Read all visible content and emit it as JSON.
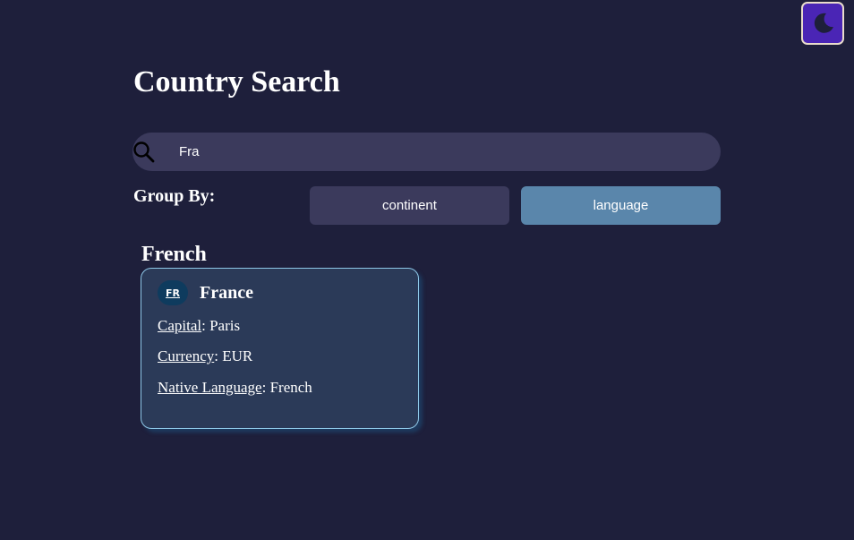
{
  "header": {
    "title": "Country Search",
    "theme_toggle_icon": "moon-icon"
  },
  "search": {
    "value": "Fra",
    "icon": "search-icon"
  },
  "group_by": {
    "label": "Group By:",
    "options": [
      {
        "label": "continent",
        "selected": false
      },
      {
        "label": "language",
        "selected": true
      }
    ]
  },
  "results": {
    "groups": [
      {
        "heading": "French",
        "countries": [
          {
            "code": "FR",
            "name": "France",
            "capital_label": "Capital",
            "capital": "Paris",
            "currency_label": "Currency",
            "currency": "EUR",
            "native_language_label": "Native Language",
            "native_language": "French"
          }
        ]
      }
    ]
  },
  "colors": {
    "background": "#1e1f3b",
    "surface": "#3b3a5c",
    "accent": "#5a86ab",
    "card": "#2b3a58",
    "toggle": "#4a25b5"
  }
}
